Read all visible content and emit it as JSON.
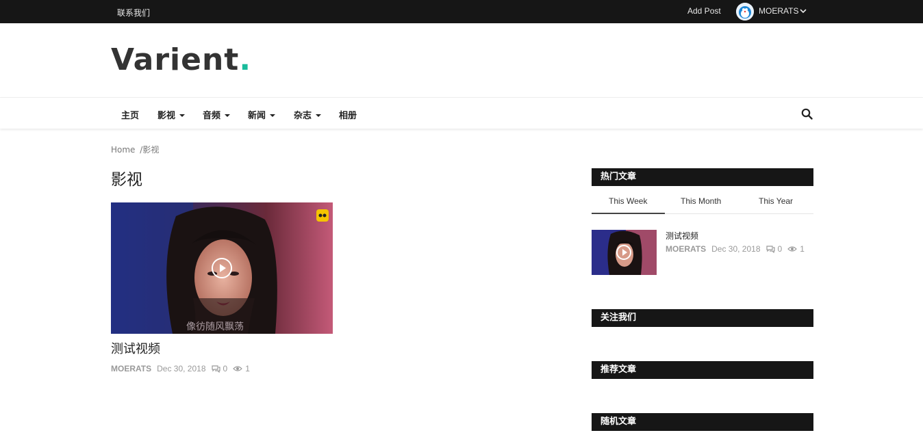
{
  "topbar": {
    "contact_label": "联系我们",
    "add_post_label": "Add Post",
    "username": "MOERATS"
  },
  "logo": {
    "text": "Varient",
    "dot": ".",
    "accent_color": "#1abc9c"
  },
  "nav": {
    "items": [
      {
        "label": "主页",
        "dropdown": false
      },
      {
        "label": "影视",
        "dropdown": true
      },
      {
        "label": "音频",
        "dropdown": true
      },
      {
        "label": "新闻",
        "dropdown": true
      },
      {
        "label": "杂志",
        "dropdown": true
      },
      {
        "label": "相册",
        "dropdown": false
      }
    ],
    "search_icon": "search-icon"
  },
  "breadcrumb": {
    "home": "Home",
    "separator": "/",
    "current": "影视"
  },
  "page_title": "影视",
  "post": {
    "title": "测试视频",
    "author": "MOERATS",
    "date": "Dec 30, 2018",
    "comments": "0",
    "views": "1",
    "watermark_text": "像彷随风飘荡"
  },
  "sidebar": {
    "popular": {
      "heading": "热门文章",
      "tabs": [
        "This Week",
        "This Month",
        "This Year"
      ],
      "active_tab": "This Week",
      "items": [
        {
          "title": "测试视频",
          "author": "MOERATS",
          "date": "Dec 30, 2018",
          "comments": "0",
          "views": "1"
        }
      ]
    },
    "follow_heading": "关注我们",
    "recommended_heading": "推荐文章",
    "random_heading": "随机文章"
  }
}
